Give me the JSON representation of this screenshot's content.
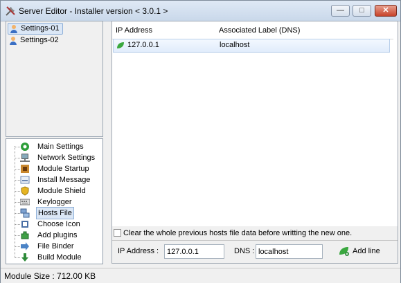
{
  "window": {
    "title": "Server Editor - Installer version < 3.0.1 >"
  },
  "settings_list": [
    {
      "label": "Settings-01",
      "selected": true
    },
    {
      "label": "Settings-02",
      "selected": false
    }
  ],
  "tree": {
    "items": [
      {
        "label": "Main Settings",
        "icon": "main-settings-icon"
      },
      {
        "label": "Network Settings",
        "icon": "network-icon"
      },
      {
        "label": "Module Startup",
        "icon": "startup-icon"
      },
      {
        "label": "Install Message",
        "icon": "message-icon"
      },
      {
        "label": "Module Shield",
        "icon": "shield-icon"
      },
      {
        "label": "Keylogger",
        "icon": "keyboard-icon"
      },
      {
        "label": "Hosts File",
        "icon": "hosts-icon",
        "selected": true
      },
      {
        "label": "Choose Icon",
        "icon": "choose-icon-icon"
      },
      {
        "label": "Add plugins",
        "icon": "plugin-icon"
      },
      {
        "label": "File Binder",
        "icon": "binder-icon"
      },
      {
        "label": "Build Module",
        "icon": "build-icon"
      }
    ]
  },
  "hosts_table": {
    "columns": [
      "IP Address",
      "Associated Label (DNS)"
    ],
    "rows": [
      {
        "ip": "127.0.0.1",
        "label": "localhost"
      }
    ]
  },
  "options": {
    "clear_hosts_label": "Clear the whole previous hosts file data before writting the new one.",
    "clear_hosts_checked": false
  },
  "form": {
    "ip_label": "IP Address :",
    "ip_value": "127.0.0.1",
    "dns_label": "DNS :",
    "dns_value": "localhost",
    "add_button": "Add line"
  },
  "status": {
    "text": "Module Size : 712.00 KB"
  },
  "colors": {
    "selection": "#dbe7f6",
    "selection_border": "#8fb0d8",
    "title_gradient_top": "#dfe9f5",
    "close_button": "#c7432a"
  }
}
